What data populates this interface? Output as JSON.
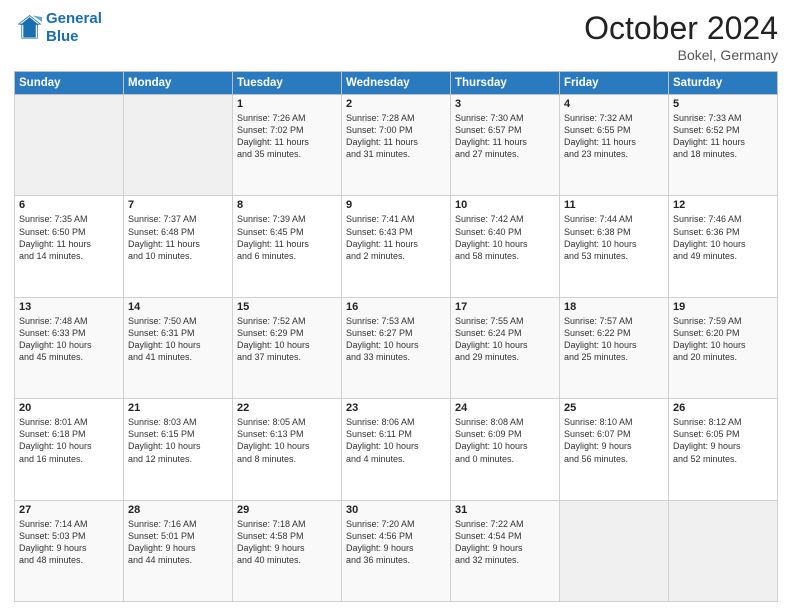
{
  "header": {
    "logo_line1": "General",
    "logo_line2": "Blue",
    "month": "October 2024",
    "location": "Bokel, Germany"
  },
  "weekdays": [
    "Sunday",
    "Monday",
    "Tuesday",
    "Wednesday",
    "Thursday",
    "Friday",
    "Saturday"
  ],
  "rows": [
    [
      {
        "day": "",
        "text": ""
      },
      {
        "day": "",
        "text": ""
      },
      {
        "day": "1",
        "text": "Sunrise: 7:26 AM\nSunset: 7:02 PM\nDaylight: 11 hours\nand 35 minutes."
      },
      {
        "day": "2",
        "text": "Sunrise: 7:28 AM\nSunset: 7:00 PM\nDaylight: 11 hours\nand 31 minutes."
      },
      {
        "day": "3",
        "text": "Sunrise: 7:30 AM\nSunset: 6:57 PM\nDaylight: 11 hours\nand 27 minutes."
      },
      {
        "day": "4",
        "text": "Sunrise: 7:32 AM\nSunset: 6:55 PM\nDaylight: 11 hours\nand 23 minutes."
      },
      {
        "day": "5",
        "text": "Sunrise: 7:33 AM\nSunset: 6:52 PM\nDaylight: 11 hours\nand 18 minutes."
      }
    ],
    [
      {
        "day": "6",
        "text": "Sunrise: 7:35 AM\nSunset: 6:50 PM\nDaylight: 11 hours\nand 14 minutes."
      },
      {
        "day": "7",
        "text": "Sunrise: 7:37 AM\nSunset: 6:48 PM\nDaylight: 11 hours\nand 10 minutes."
      },
      {
        "day": "8",
        "text": "Sunrise: 7:39 AM\nSunset: 6:45 PM\nDaylight: 11 hours\nand 6 minutes."
      },
      {
        "day": "9",
        "text": "Sunrise: 7:41 AM\nSunset: 6:43 PM\nDaylight: 11 hours\nand 2 minutes."
      },
      {
        "day": "10",
        "text": "Sunrise: 7:42 AM\nSunset: 6:40 PM\nDaylight: 10 hours\nand 58 minutes."
      },
      {
        "day": "11",
        "text": "Sunrise: 7:44 AM\nSunset: 6:38 PM\nDaylight: 10 hours\nand 53 minutes."
      },
      {
        "day": "12",
        "text": "Sunrise: 7:46 AM\nSunset: 6:36 PM\nDaylight: 10 hours\nand 49 minutes."
      }
    ],
    [
      {
        "day": "13",
        "text": "Sunrise: 7:48 AM\nSunset: 6:33 PM\nDaylight: 10 hours\nand 45 minutes."
      },
      {
        "day": "14",
        "text": "Sunrise: 7:50 AM\nSunset: 6:31 PM\nDaylight: 10 hours\nand 41 minutes."
      },
      {
        "day": "15",
        "text": "Sunrise: 7:52 AM\nSunset: 6:29 PM\nDaylight: 10 hours\nand 37 minutes."
      },
      {
        "day": "16",
        "text": "Sunrise: 7:53 AM\nSunset: 6:27 PM\nDaylight: 10 hours\nand 33 minutes."
      },
      {
        "day": "17",
        "text": "Sunrise: 7:55 AM\nSunset: 6:24 PM\nDaylight: 10 hours\nand 29 minutes."
      },
      {
        "day": "18",
        "text": "Sunrise: 7:57 AM\nSunset: 6:22 PM\nDaylight: 10 hours\nand 25 minutes."
      },
      {
        "day": "19",
        "text": "Sunrise: 7:59 AM\nSunset: 6:20 PM\nDaylight: 10 hours\nand 20 minutes."
      }
    ],
    [
      {
        "day": "20",
        "text": "Sunrise: 8:01 AM\nSunset: 6:18 PM\nDaylight: 10 hours\nand 16 minutes."
      },
      {
        "day": "21",
        "text": "Sunrise: 8:03 AM\nSunset: 6:15 PM\nDaylight: 10 hours\nand 12 minutes."
      },
      {
        "day": "22",
        "text": "Sunrise: 8:05 AM\nSunset: 6:13 PM\nDaylight: 10 hours\nand 8 minutes."
      },
      {
        "day": "23",
        "text": "Sunrise: 8:06 AM\nSunset: 6:11 PM\nDaylight: 10 hours\nand 4 minutes."
      },
      {
        "day": "24",
        "text": "Sunrise: 8:08 AM\nSunset: 6:09 PM\nDaylight: 10 hours\nand 0 minutes."
      },
      {
        "day": "25",
        "text": "Sunrise: 8:10 AM\nSunset: 6:07 PM\nDaylight: 9 hours\nand 56 minutes."
      },
      {
        "day": "26",
        "text": "Sunrise: 8:12 AM\nSunset: 6:05 PM\nDaylight: 9 hours\nand 52 minutes."
      }
    ],
    [
      {
        "day": "27",
        "text": "Sunrise: 7:14 AM\nSunset: 5:03 PM\nDaylight: 9 hours\nand 48 minutes."
      },
      {
        "day": "28",
        "text": "Sunrise: 7:16 AM\nSunset: 5:01 PM\nDaylight: 9 hours\nand 44 minutes."
      },
      {
        "day": "29",
        "text": "Sunrise: 7:18 AM\nSunset: 4:58 PM\nDaylight: 9 hours\nand 40 minutes."
      },
      {
        "day": "30",
        "text": "Sunrise: 7:20 AM\nSunset: 4:56 PM\nDaylight: 9 hours\nand 36 minutes."
      },
      {
        "day": "31",
        "text": "Sunrise: 7:22 AM\nSunset: 4:54 PM\nDaylight: 9 hours\nand 32 minutes."
      },
      {
        "day": "",
        "text": ""
      },
      {
        "day": "",
        "text": ""
      }
    ]
  ]
}
